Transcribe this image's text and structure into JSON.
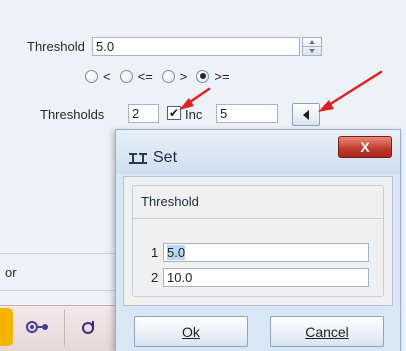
{
  "threshold": {
    "label": "Threshold",
    "value": "5.0"
  },
  "comparison": {
    "options": [
      {
        "symbol": "<",
        "selected": false
      },
      {
        "symbol": "<=",
        "selected": false
      },
      {
        "symbol": ">",
        "selected": false
      },
      {
        "symbol": ">=",
        "selected": true
      }
    ]
  },
  "thresholds": {
    "label": "Thresholds",
    "count": "2",
    "inc_checked": true,
    "inc_label": "Inc",
    "inc_value": "5"
  },
  "left_panel": {
    "clipped_label": "or"
  },
  "dialog": {
    "title": "Set",
    "close_label": "X",
    "group_label": "Threshold",
    "rows": [
      {
        "index": "1",
        "value": "5.0"
      },
      {
        "index": "2",
        "value": "10.0"
      }
    ],
    "ok_label": "Ok",
    "cancel_label": "Cancel"
  },
  "colors": {
    "annotation_arrow": "#e02020",
    "accent": "#3d7bd0"
  }
}
